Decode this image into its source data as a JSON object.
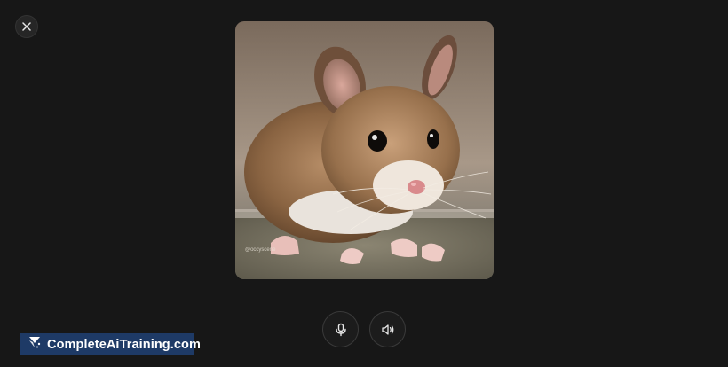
{
  "close": {
    "icon": "close-icon"
  },
  "image": {
    "subject": "mouse",
    "watermark_text": "@occyscene"
  },
  "controls": {
    "mic_icon": "microphone-icon",
    "speaker_icon": "speaker-icon"
  },
  "watermark": {
    "text": "CompleteAiTraining.com",
    "logo_icon": "logo-icon",
    "background": "#1e3a66"
  },
  "colors": {
    "background": "#171717",
    "button_border": "#3a3a3a"
  }
}
